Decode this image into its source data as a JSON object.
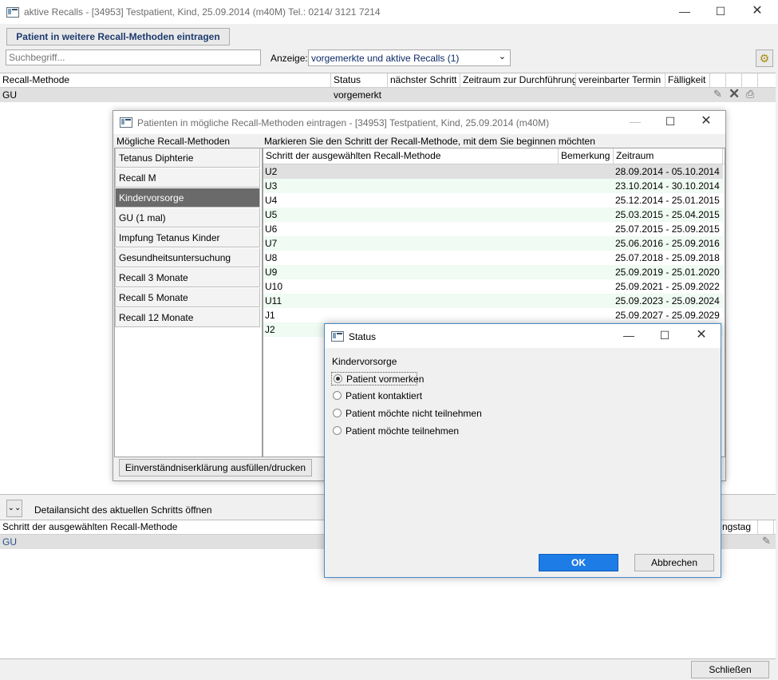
{
  "main": {
    "title": "aktive Recalls - [34953] Testpatient, Kind, 25.09.2014 (m40M)  Tel.: 0214/ 3121 7214",
    "add_button": "Patient in weitere Recall-Methoden eintragen",
    "search_placeholder": "Suchbegriff...",
    "anzeige_label": "Anzeige:",
    "anzeige_value": "vorgemerkte und aktive Recalls (1)",
    "columns": [
      "Recall-Methode",
      "Status",
      "nächster Schritt",
      "Zeitraum zur Durchführung",
      "vereinbarter Termin",
      "Fälligkeit"
    ],
    "row": {
      "method": "GU",
      "status": "vorgemerkt"
    },
    "detail_toggle": "Detailansicht des aktuellen Schritts öffnen",
    "detail_col1": "Schritt der ausgewählten Recall-Methode",
    "detail_col_right": "ngstag",
    "detail_row": "GU",
    "close_button": "Schließen"
  },
  "dialog1": {
    "title": "Patienten in mögliche Recall-Methoden eintragen - [34953] Testpatient, Kind, 25.09.2014 (m40M)",
    "methods_label": "Mögliche Recall-Methoden",
    "steps_label": "Markieren Sie den Schritt der Recall-Methode, mit dem Sie beginnen möchten",
    "methods": [
      "Tetanus Diphterie",
      "Recall M",
      "Kindervorsorge",
      "GU (1 mal)",
      "Impfung Tetanus Kinder",
      "Gesundheitsuntersuchung",
      "Recall 3 Monate",
      "Recall 5 Monate",
      "Recall 12 Monate"
    ],
    "selected_method": 2,
    "columns": [
      "Schritt der ausgewählten Recall-Methode",
      "Bemerkung",
      "Zeitraum"
    ],
    "steps": [
      {
        "step": "U2",
        "period": "28.09.2014 - 05.10.2014"
      },
      {
        "step": "U3",
        "period": "23.10.2014 - 30.10.2014"
      },
      {
        "step": "U4",
        "period": "25.12.2014 - 25.01.2015"
      },
      {
        "step": "U5",
        "period": "25.03.2015 - 25.04.2015"
      },
      {
        "step": "U6",
        "period": "25.07.2015 - 25.09.2015"
      },
      {
        "step": "U7",
        "period": "25.06.2016 - 25.09.2016"
      },
      {
        "step": "U8",
        "period": "25.07.2018 - 25.09.2018"
      },
      {
        "step": "U9",
        "period": "25.09.2019 - 25.01.2020"
      },
      {
        "step": "U10",
        "period": "25.09.2021 - 25.09.2022"
      },
      {
        "step": "U11",
        "period": "25.09.2023 - 25.09.2024"
      },
      {
        "step": "J1",
        "period": "25.09.2027 - 25.09.2029"
      },
      {
        "step": "J2",
        "period": ""
      }
    ],
    "consent_button": "Einverständniserklärung ausfüllen/drucken"
  },
  "status_dialog": {
    "title": "Status",
    "group_label": "Kindervorsorge",
    "options": [
      "Patient vormerken",
      "Patient kontaktiert",
      "Patient möchte nicht teilnehmen",
      "Patient möchte teilnehmen"
    ],
    "selected": 0,
    "ok": "OK",
    "cancel": "Abbrechen"
  },
  "icons": {
    "app": "window-app-icon",
    "edit": "pencil-icon",
    "delete": "x-delete-icon",
    "print": "printer-icon",
    "settings": "gear-icon"
  },
  "colors": {
    "selected_row": "#e0e0e0",
    "alt_row": "#effbf3",
    "ok_button": "#1e7ce6",
    "selected_method": "#6a6a6a"
  }
}
